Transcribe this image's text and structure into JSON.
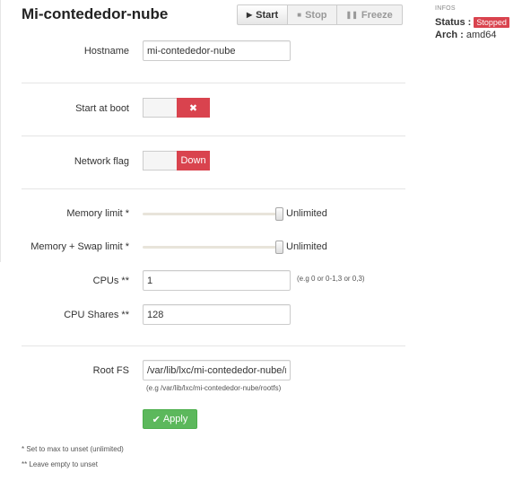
{
  "container": {
    "title": "Mi-contededor-nube"
  },
  "toolbar": {
    "start_label": "Start",
    "stop_label": "Stop",
    "freeze_label": "Freeze"
  },
  "form": {
    "hostname": {
      "label": "Hostname",
      "value": "mi-contededor-nube"
    },
    "start_at_boot": {
      "label": "Start at boot",
      "state_symbol": "✖"
    },
    "network_flag": {
      "label": "Network flag",
      "state_label": "Down"
    },
    "memory_limit": {
      "label": "Memory limit *",
      "value_text": "Unlimited",
      "fraction": 1.0
    },
    "memory_swap_limit": {
      "label": "Memory + Swap limit *",
      "value_text": "Unlimited",
      "fraction": 1.0
    },
    "cpus": {
      "label": "CPUs **",
      "value": "1",
      "hint": "(e.g 0 or 0-1,3 or 0,3)"
    },
    "cpu_shares": {
      "label": "CPU Shares **",
      "value": "128"
    },
    "root_fs": {
      "label": "Root FS",
      "value": "/var/lib/lxc/mi-contededor-nube/rootfs",
      "hint": "(e.g /var/lib/lxc/mi-contededor-nube/rootfs)"
    },
    "apply_label": "Apply"
  },
  "footnotes": {
    "note1": "* Set to max to unset (unlimited)",
    "note2": "** Leave empty to unset"
  },
  "infos": {
    "heading": "INFOS",
    "status_label": "Status :",
    "status_value": "Stopped",
    "arch_label": "Arch :",
    "arch_value": "amd64"
  },
  "colors": {
    "danger": "#d9434e",
    "success": "#5cb85c"
  },
  "icons": {
    "start": "play-icon",
    "stop": "stop-icon",
    "freeze": "pause-icon",
    "apply": "check-icon"
  }
}
